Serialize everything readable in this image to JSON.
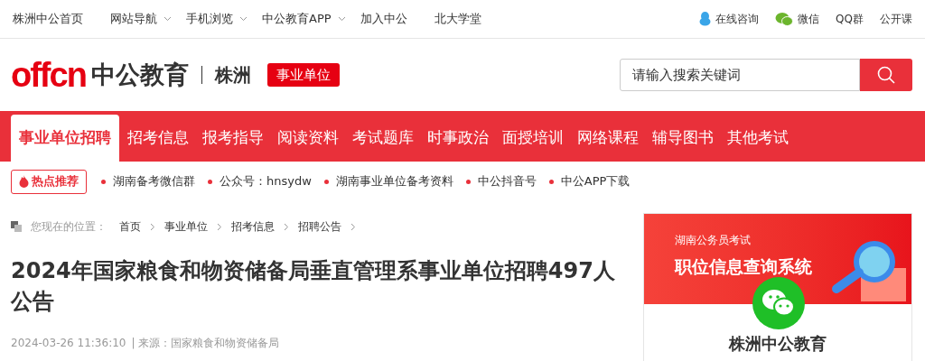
{
  "top_nav": {
    "links": [
      {
        "label": "株洲中公首页",
        "dropdown": false
      },
      {
        "label": "网站导航",
        "dropdown": true
      },
      {
        "label": "手机浏览",
        "dropdown": true
      },
      {
        "label": "中公教育APP",
        "dropdown": true
      },
      {
        "label": "加入中公",
        "dropdown": false
      },
      {
        "label": "北大学堂",
        "dropdown": false
      }
    ],
    "right_links": [
      {
        "label": "在线咨询",
        "kind": "chat"
      },
      {
        "label": "微信",
        "kind": "wechat"
      },
      {
        "label": "QQ群",
        "kind": "none"
      },
      {
        "label": "公开课",
        "kind": "none"
      }
    ]
  },
  "header": {
    "logo_latin": "offcn",
    "logo_text": "中公教育",
    "city": "株洲",
    "badge": "事业单位",
    "search": {
      "placeholder": "请输入搜索关键词"
    }
  },
  "main_nav": [
    {
      "label": "事业单位招聘",
      "selected": true
    },
    {
      "label": "招考信息",
      "selected": false
    },
    {
      "label": "报考指导",
      "selected": false
    },
    {
      "label": "阅读资料",
      "selected": false
    },
    {
      "label": "考试题库",
      "selected": false
    },
    {
      "label": "时事政治",
      "selected": false
    },
    {
      "label": "面授培训",
      "selected": false
    },
    {
      "label": "网络课程",
      "selected": false
    },
    {
      "label": "辅导图书",
      "selected": false
    },
    {
      "label": "其他考试",
      "selected": false
    }
  ],
  "hot": {
    "label": "热点推荐",
    "links": [
      "湖南备考微信群",
      "公众号：hnsydw",
      "湖南事业单位备考资料",
      "中公抖音号",
      "中公APP下载"
    ]
  },
  "breadcrumb": {
    "label": "您现在的位置：",
    "items": [
      "首页",
      "事业单位",
      "招考信息",
      "招聘公告"
    ]
  },
  "article": {
    "title": "2024年国家粮食和物资储备局垂直管理系事业单位招聘497人公告",
    "date": "2024-03-26 11:36:10",
    "source": "| 来源：国家粮食和物资储备局"
  },
  "sidebar": {
    "banner_subtitle": "湖南公务员考试",
    "banner_title": "职位信息查询系统",
    "card_title": "株洲中公教育"
  }
}
